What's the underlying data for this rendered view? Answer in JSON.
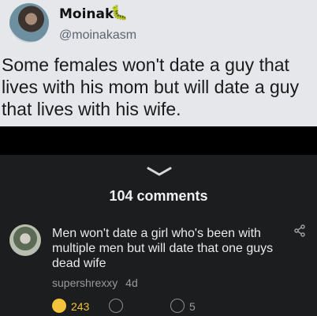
{
  "tweet": {
    "name": "Moinak",
    "name_emoji": "🐛",
    "handle": "@moinakasm",
    "text": "Some females won't date a guy that lives with his mom but will date a guy that lives with his wife."
  },
  "comments": {
    "count_label": "104 comments",
    "comment": {
      "text": "Men won't date a girl who's been with multiple men but will date that one guys dead wife",
      "author": "supershrexxy",
      "age": "4d",
      "reaction_count": "243",
      "reply_count": "5"
    }
  },
  "colors": {
    "tweet_bg": "#e6e7eb",
    "panel_bg": "#1c1d1f",
    "reaction_yellow": "#f3c33a"
  }
}
